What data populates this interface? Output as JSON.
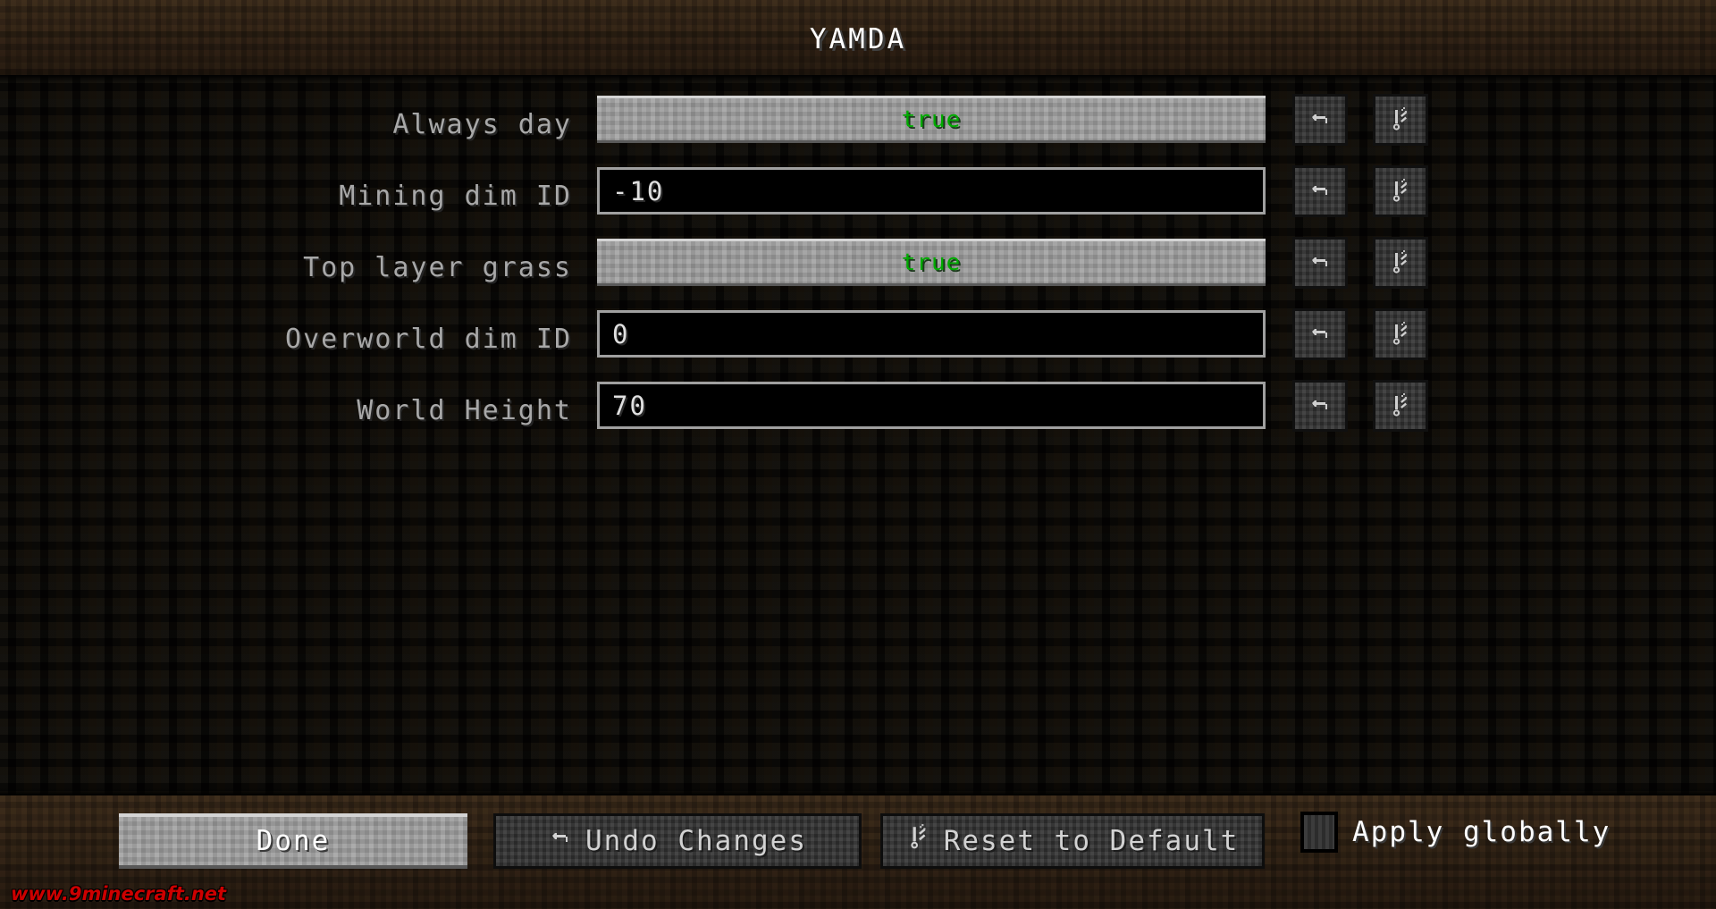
{
  "window": {
    "title": "YAMDA"
  },
  "config_rows": [
    {
      "label": "Always day",
      "control_type": "toggle",
      "value": "true",
      "value_color": "#00aa00",
      "undo_icon": "undo-arrow-icon",
      "reset_icon": "reset-default-icon"
    },
    {
      "label": "Mining dim ID",
      "control_type": "text",
      "value": "-10",
      "undo_icon": "undo-arrow-icon",
      "reset_icon": "reset-default-icon"
    },
    {
      "label": "Top layer grass",
      "control_type": "toggle",
      "value": "true",
      "value_color": "#00aa00",
      "undo_icon": "undo-arrow-icon",
      "reset_icon": "reset-default-icon"
    },
    {
      "label": "Overworld dim ID",
      "control_type": "text",
      "value": "0",
      "undo_icon": "undo-arrow-icon",
      "reset_icon": "reset-default-icon"
    },
    {
      "label": "World Height",
      "control_type": "text",
      "value": "70",
      "undo_icon": "undo-arrow-icon",
      "reset_icon": "reset-default-icon"
    }
  ],
  "footer": {
    "done_label": "Done",
    "undo_changes_label": "Undo Changes",
    "undo_changes_icon": "undo-arrow-icon",
    "reset_default_label": "Reset to Default",
    "reset_default_icon": "reset-default-icon",
    "apply_globally_label": "Apply globally",
    "apply_globally_checked": false
  },
  "watermark": {
    "text": "www.9minecraft.net",
    "color": "#cc0000"
  },
  "colors": {
    "dirt_band": "#2b1f14",
    "body_background": "#0c0a06",
    "label_text": "#a8a8a8",
    "toggle_true_text": "#00aa00",
    "input_background": "#000000",
    "input_border": "#a0a0a0",
    "light_button": "#9a9a9a",
    "dark_button": "#333333"
  }
}
